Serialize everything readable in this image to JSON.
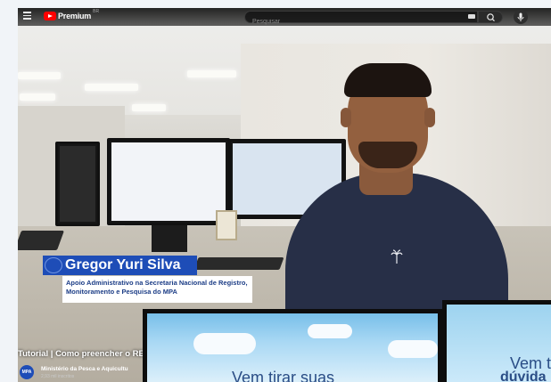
{
  "header": {
    "brand": "Premium",
    "country": "BR",
    "search_placeholder": "Pesquisar"
  },
  "overlay": {
    "name": "Gregor Yuri Silva",
    "role": "Apoio Administrativo na Secretaria Nacional de Registro, Monitoramento e Pesquisa do MPA"
  },
  "video": {
    "title": "Tutorial | Como preencher o RE",
    "channel": "Ministério da Pesca e Aquicultu",
    "channel_avatar": "MPA",
    "subscribers": "2,93 mil inscritos"
  },
  "end_cards": [
    {
      "caption": "Vem tirar suas"
    },
    {
      "caption_line1": "Vem t",
      "caption_line2": "dúvida"
    }
  ],
  "colors": {
    "accent": "#1e4db7",
    "brand_red": "#ff0000",
    "shirt": "#272f47"
  },
  "icons": [
    "menu-icon",
    "youtube-logo-icon",
    "keyboard-icon",
    "search-icon",
    "mic-icon",
    "palm-tree-icon"
  ]
}
